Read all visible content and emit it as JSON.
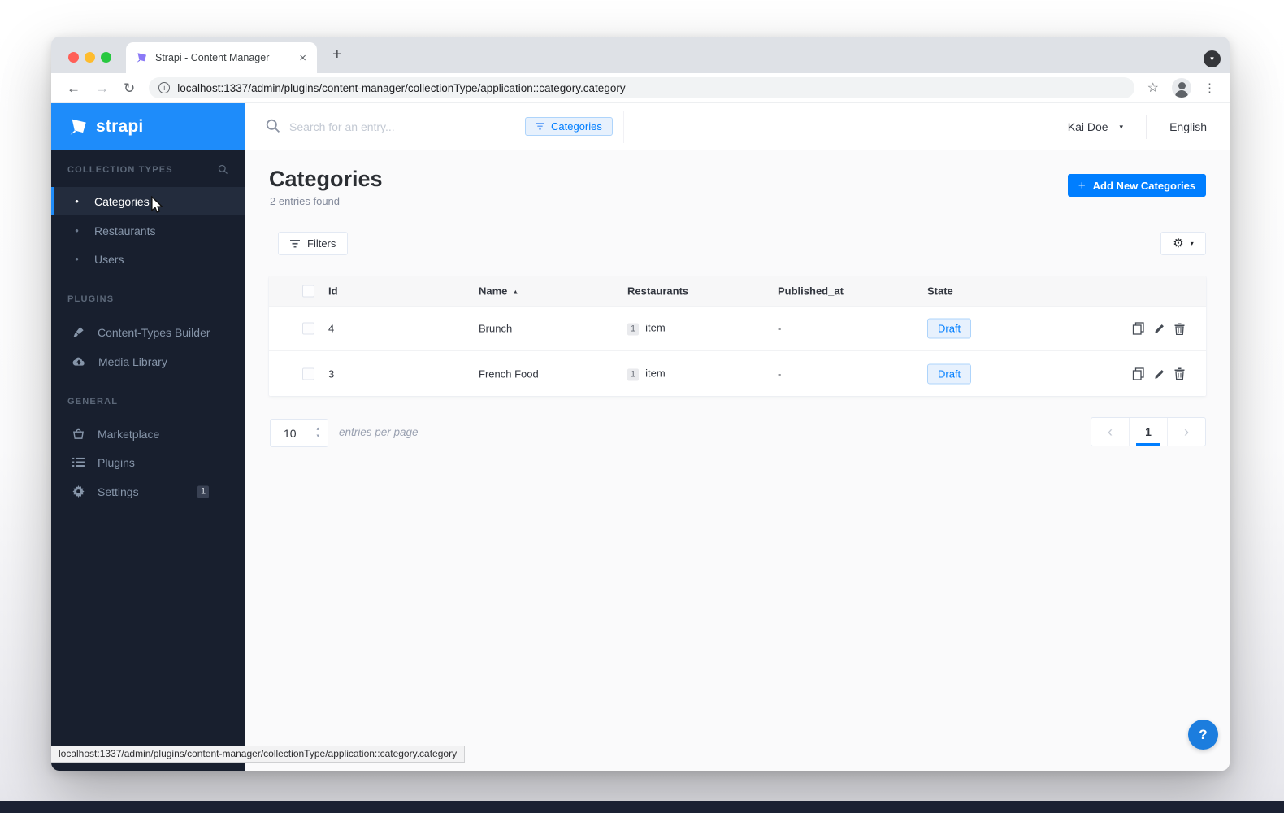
{
  "icons": {
    "back": "←",
    "forward": "→",
    "reload": "↻",
    "star": "☆",
    "menu_dots": "⋮",
    "close": "×",
    "new_tab": "+",
    "tab_chevron": "▾",
    "info": "i",
    "sort_asc": "▲",
    "user_caret": "▾",
    "gear": "⚙",
    "gear_caret": "▾",
    "prev": "‹",
    "next": "›",
    "stepper_up": "▴",
    "stepper_down": "▾",
    "bullet": "•",
    "help": "?",
    "add_plus": "+"
  },
  "colors": {
    "accent_blue": "#007eff",
    "strapi_header_blue": "#1e8cfa",
    "sidebar_dark": "#181f2e",
    "draft_badge_bg": "#e7f1fd",
    "draft_badge_border": "#aed4fb"
  },
  "browser": {
    "tab_title": "Strapi - Content Manager",
    "url": "localhost:1337/admin/plugins/content-manager/collectionType/application::category.category",
    "status_url": "localhost:1337/admin/plugins/content-manager/collectionType/application::category.category"
  },
  "sidebar": {
    "logo_text": "strapi",
    "sections": [
      {
        "label": "COLLECTION TYPES",
        "items": [
          {
            "label": "Categories"
          },
          {
            "label": "Restaurants"
          },
          {
            "label": "Users"
          }
        ]
      },
      {
        "label": "PLUGINS",
        "items": [
          {
            "label": "Content-Types Builder"
          },
          {
            "label": "Media Library"
          }
        ]
      },
      {
        "label": "GENERAL",
        "items": [
          {
            "label": "Marketplace"
          },
          {
            "label": "Plugins"
          },
          {
            "label": "Settings",
            "badge": "1"
          }
        ]
      }
    ]
  },
  "topbar": {
    "search_placeholder": "Search for an entry...",
    "filter_chip": "Categories",
    "user_name": "Kai Doe",
    "language": "English"
  },
  "page": {
    "title": "Categories",
    "subtitle": "2 entries found",
    "add_button": "Add New Categories",
    "filters_button": "Filters"
  },
  "table": {
    "columns": [
      "Id",
      "Name",
      "Restaurants",
      "Published_at",
      "State"
    ],
    "sorted_by": "Name",
    "rows": [
      {
        "id": "4",
        "name": "Brunch",
        "count": "1",
        "count_label": "item",
        "published_at": "-",
        "state": "Draft"
      },
      {
        "id": "3",
        "name": "French Food",
        "count": "1",
        "count_label": "item",
        "published_at": "-",
        "state": "Draft"
      }
    ]
  },
  "pagination": {
    "page_size": "10",
    "label": "entries per page",
    "page": "1"
  }
}
